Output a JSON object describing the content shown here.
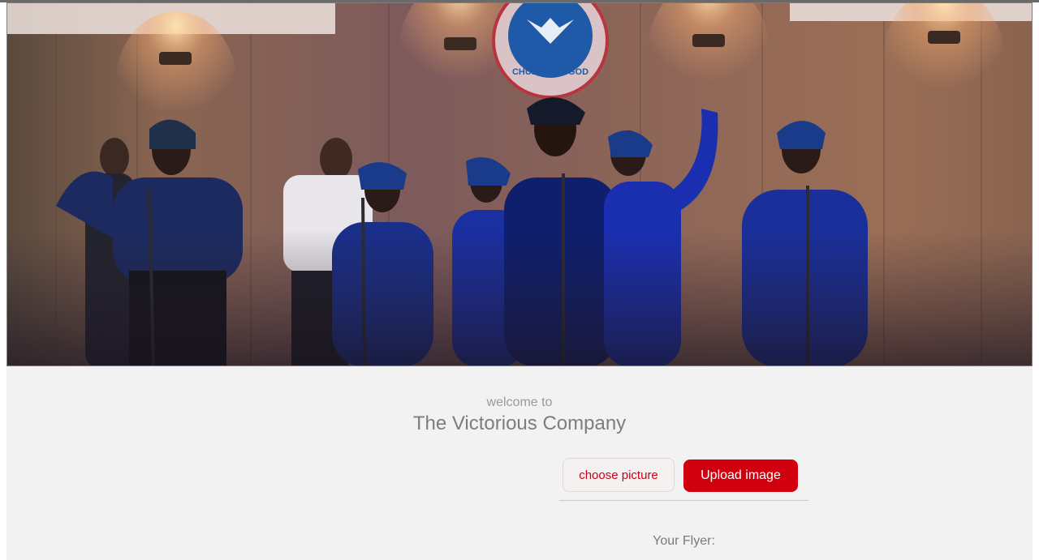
{
  "hero": {
    "banner_logo_text": "CHURCH OF GOD"
  },
  "welcome": {
    "subtitle": "welcome to",
    "title": "The Victorious Company"
  },
  "upload": {
    "choose_label": "choose picture",
    "upload_label": "Upload image"
  },
  "flyer": {
    "label": "Your Flyer:"
  },
  "colors": {
    "accent": "#d0000f",
    "background": "#f2f2f2"
  }
}
